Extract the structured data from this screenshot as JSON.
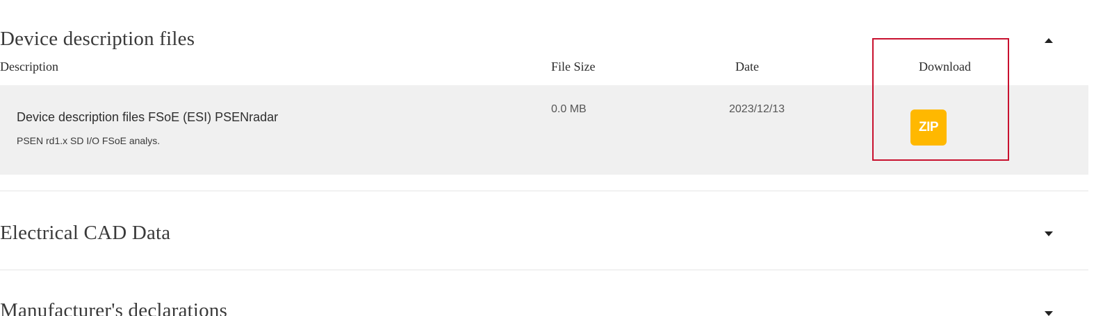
{
  "sections": [
    {
      "title": "Device description files",
      "expanded": true,
      "columns": {
        "description": "Description",
        "file_size": "File Size",
        "date": "Date",
        "download": "Download"
      },
      "files": [
        {
          "name": "Device description files FSoE (ESI) PSENradar",
          "description": "PSEN rd1.x SD I/O FSoE analys.",
          "file_size": "0.0 MB",
          "date": "2023/12/13",
          "download_icon": "zip-icon",
          "download_label": "ZIP",
          "download_color": "#ffb800"
        }
      ]
    },
    {
      "title": "Electrical CAD Data",
      "expanded": false
    },
    {
      "title": "Manufacturer's declarations",
      "expanded": false
    }
  ],
  "colors": {
    "highlight": "#c8102e",
    "row_background": "#f0f0f0"
  }
}
